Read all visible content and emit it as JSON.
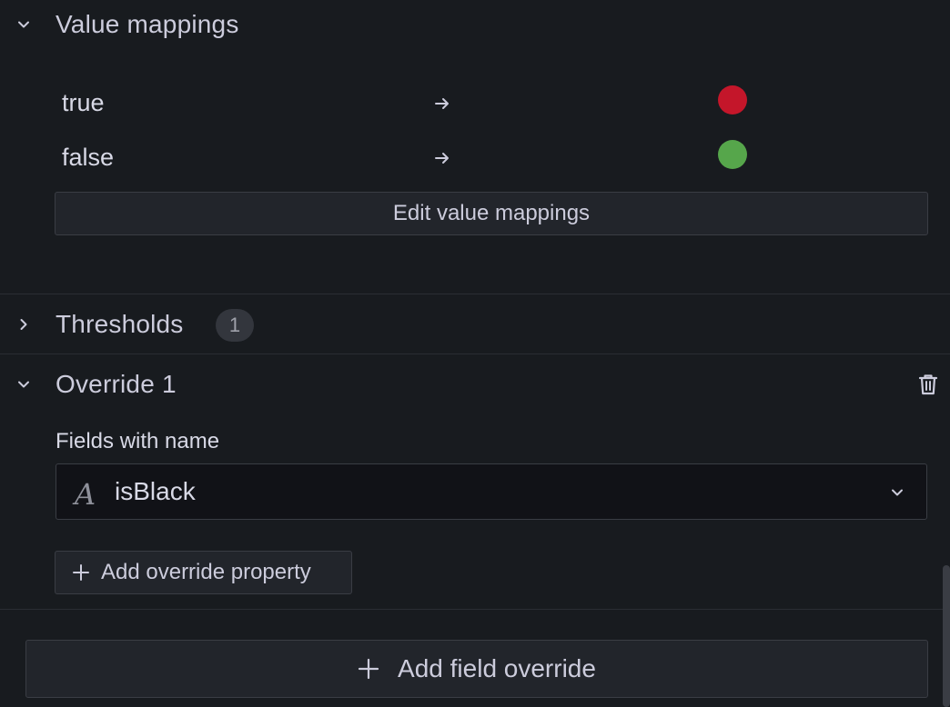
{
  "value_mappings": {
    "title": "Value mappings",
    "rows": [
      {
        "value": "true",
        "arrow_icon": "arrow-right-icon",
        "color": "#c4162a"
      },
      {
        "value": "false",
        "arrow_icon": "arrow-right-icon",
        "color": "#56a64b"
      }
    ],
    "edit_button_label": "Edit value mappings"
  },
  "thresholds": {
    "title": "Thresholds",
    "count": "1"
  },
  "override": {
    "title": "Override 1",
    "matcher_label": "Fields with name",
    "matcher_icon_glyph": "A",
    "matcher_value": "isBlack",
    "add_property_label": "Add override property"
  },
  "add_field_override_label": "Add field override",
  "colors": {
    "background": "#181b1f",
    "text": "#ccccdc",
    "border": "#3a3d44"
  }
}
